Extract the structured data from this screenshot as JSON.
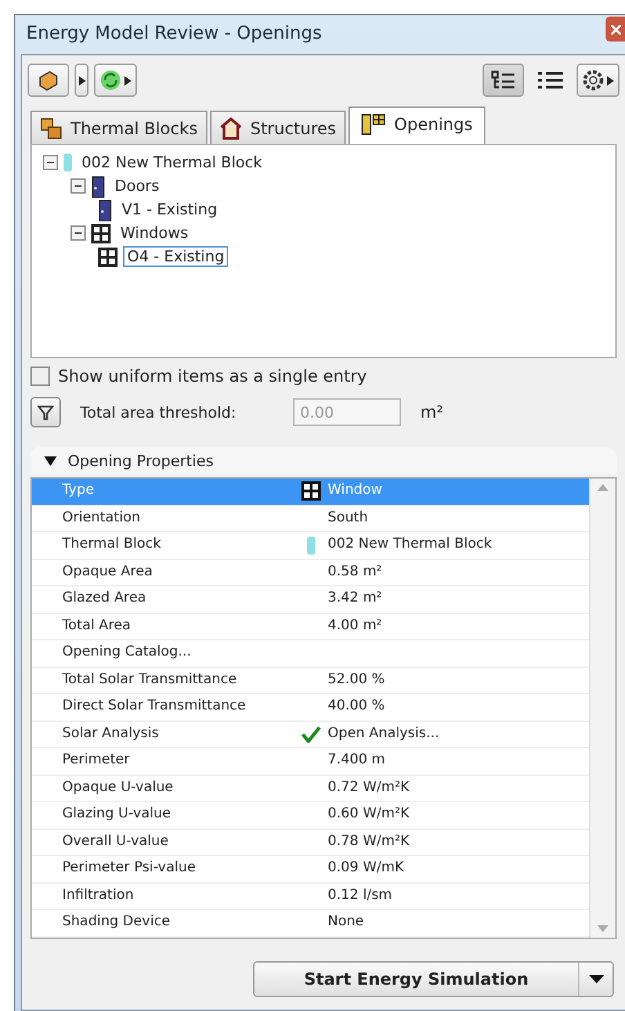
{
  "window": {
    "title": "Energy Model Review - Openings"
  },
  "toolbar": {
    "view_modes": [
      {
        "kind": "tree",
        "selected": true
      },
      {
        "kind": "list",
        "selected": false
      }
    ]
  },
  "tabs": [
    {
      "label": "Thermal Blocks",
      "kind": "blocks",
      "selected": false
    },
    {
      "label": "Structures",
      "kind": "structures",
      "selected": false
    },
    {
      "label": "Openings",
      "kind": "openings",
      "selected": true
    }
  ],
  "tree": [
    {
      "label": "002 New Thermal Block",
      "kind": "block",
      "expanded": true,
      "selected": false,
      "children": [
        {
          "label": "Doors",
          "kind": "door",
          "expanded": true,
          "selected": false,
          "children": [
            {
              "label": "V1 - Existing",
              "kind": "door",
              "selected": false
            }
          ]
        },
        {
          "label": "Windows",
          "kind": "window",
          "expanded": true,
          "selected": false,
          "children": [
            {
              "label": "O4 - Existing",
              "kind": "window",
              "selected": true
            }
          ]
        }
      ]
    }
  ],
  "uniform_option": {
    "label": "Show uniform items as a single entry",
    "checked": false
  },
  "threshold": {
    "label": "Total area threshold:",
    "value": "0.00",
    "unit": "m²",
    "disabled": true
  },
  "section": {
    "title": "Opening Properties",
    "expanded": true
  },
  "properties": [
    {
      "name": "Type",
      "value": "Window",
      "kind": "window",
      "selected": true
    },
    {
      "name": "Orientation",
      "value": "South",
      "kind": "plain",
      "selected": false
    },
    {
      "name": "Thermal Block",
      "value": "002 New Thermal Block",
      "kind": "block",
      "selected": false
    },
    {
      "name": "Opaque Area",
      "value": "0.58 m²",
      "kind": "plain",
      "selected": false
    },
    {
      "name": "Glazed Area",
      "value": "3.42 m²",
      "kind": "plain",
      "selected": false
    },
    {
      "name": "Total Area",
      "value": "4.00 m²",
      "kind": "plain",
      "selected": false
    },
    {
      "name": "Opening Catalog...",
      "kind": "plain",
      "selected": false
    },
    {
      "name": "Total Solar Transmittance",
      "value": "52.00 %",
      "kind": "plain",
      "selected": false
    },
    {
      "name": "Direct Solar Transmittance",
      "value": "40.00 %",
      "kind": "plain",
      "selected": false
    },
    {
      "name": "Solar Analysis",
      "value": "Open Analysis...",
      "kind": "check",
      "selected": false
    },
    {
      "name": "Perimeter",
      "value": "7.400 m",
      "kind": "plain",
      "selected": false
    },
    {
      "name": "Opaque U-value",
      "value": "0.72 W/m²K",
      "kind": "plain",
      "selected": false
    },
    {
      "name": "Glazing U-value",
      "value": "0.60 W/m²K",
      "kind": "plain",
      "selected": false
    },
    {
      "name": "Overall U-value",
      "value": "0.78 W/m²K",
      "kind": "plain",
      "selected": false
    },
    {
      "name": "Perimeter Psi-value",
      "value": "0.09 W/mK",
      "kind": "plain",
      "selected": false
    },
    {
      "name": "Infiltration",
      "value": "0.12 l/sm",
      "kind": "plain",
      "selected": false
    },
    {
      "name": "Shading Device",
      "value": "None",
      "kind": "plain",
      "selected": false
    }
  ],
  "simulate_button": {
    "label": "Start Energy Simulation"
  }
}
